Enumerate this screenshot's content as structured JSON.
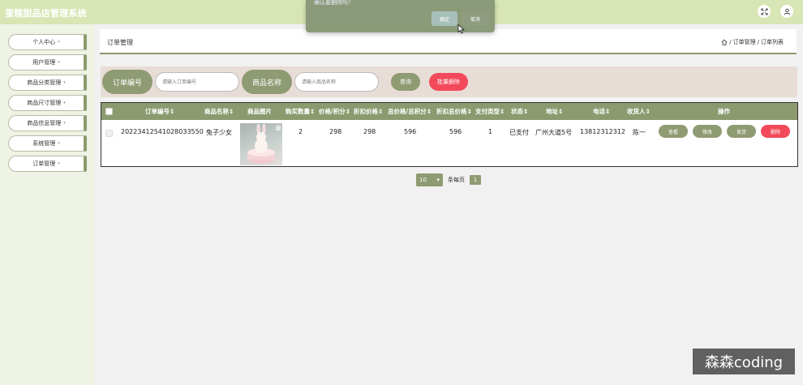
{
  "header": {
    "title": "蛋糕甜品店管理系统",
    "fullscreen_icon": "fullscreen-icon",
    "user_icon": "user-icon"
  },
  "dialog": {
    "message": "确认要删除吗？",
    "ok": "确定",
    "cancel": "取消"
  },
  "sidebar": {
    "items": [
      {
        "label": "个人中心"
      },
      {
        "label": "用户管理"
      },
      {
        "label": "商品分类管理"
      },
      {
        "label": "商品尺寸管理"
      },
      {
        "label": "商品信息管理"
      },
      {
        "label": "系统管理"
      },
      {
        "label": "订单管理"
      }
    ],
    "caret": "▾"
  },
  "page": {
    "title": "订单管理",
    "breadcrumb": [
      "订单管理",
      "订单列表"
    ],
    "sep": "/"
  },
  "search": {
    "order_label": "订单编号",
    "order_placeholder": "请输入订单编号",
    "goods_label": "商品名称",
    "goods_placeholder": "请输入商品名称",
    "query": "查询",
    "batch_delete": "批量删除"
  },
  "table": {
    "headers": [
      "订单编号",
      "商品名称",
      "商品图片",
      "购买数量",
      "价格/积分",
      "折扣价格",
      "总价格/总积分",
      "折扣总价格",
      "支付类型",
      "状态",
      "地址",
      "电话",
      "收货人",
      "操作"
    ],
    "sort_mark": "⇕",
    "rows": [
      {
        "order_no": "20223412541028033550",
        "goods_name": "兔子少女",
        "qty": "2",
        "price": "298",
        "discount_price": "298",
        "total": "596",
        "discount_total": "596",
        "pay_type": "1",
        "status": "已支付",
        "address": "广州大道5号",
        "phone": "13812312312",
        "receiver": "陈一"
      }
    ],
    "actions": [
      "查看",
      "修改",
      "发货",
      "删除"
    ]
  },
  "pager": {
    "page_size": "10",
    "per_page": "条每页",
    "current": "1"
  },
  "watermark": "森森coding"
}
